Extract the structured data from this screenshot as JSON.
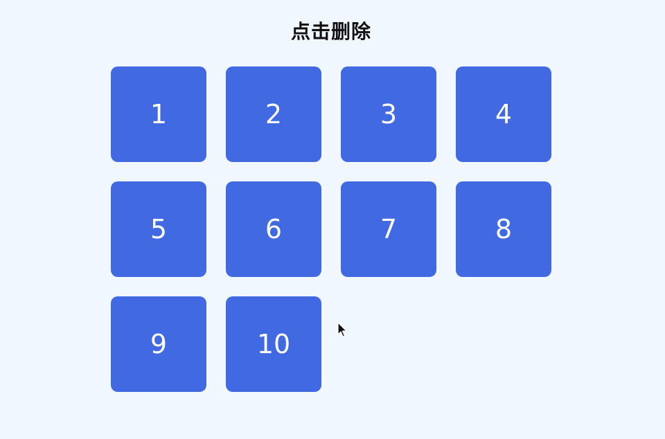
{
  "header": {
    "title": "点击删除"
  },
  "tiles": [
    {
      "label": "1"
    },
    {
      "label": "2"
    },
    {
      "label": "3"
    },
    {
      "label": "4"
    },
    {
      "label": "5"
    },
    {
      "label": "6"
    },
    {
      "label": "7"
    },
    {
      "label": "8"
    },
    {
      "label": "9"
    },
    {
      "label": "10"
    }
  ],
  "colors": {
    "background": "#f0f7ff",
    "tile": "#4169e1",
    "tile_text": "#ffffff"
  },
  "icons": {
    "cursor": "mouse-pointer-icon"
  }
}
